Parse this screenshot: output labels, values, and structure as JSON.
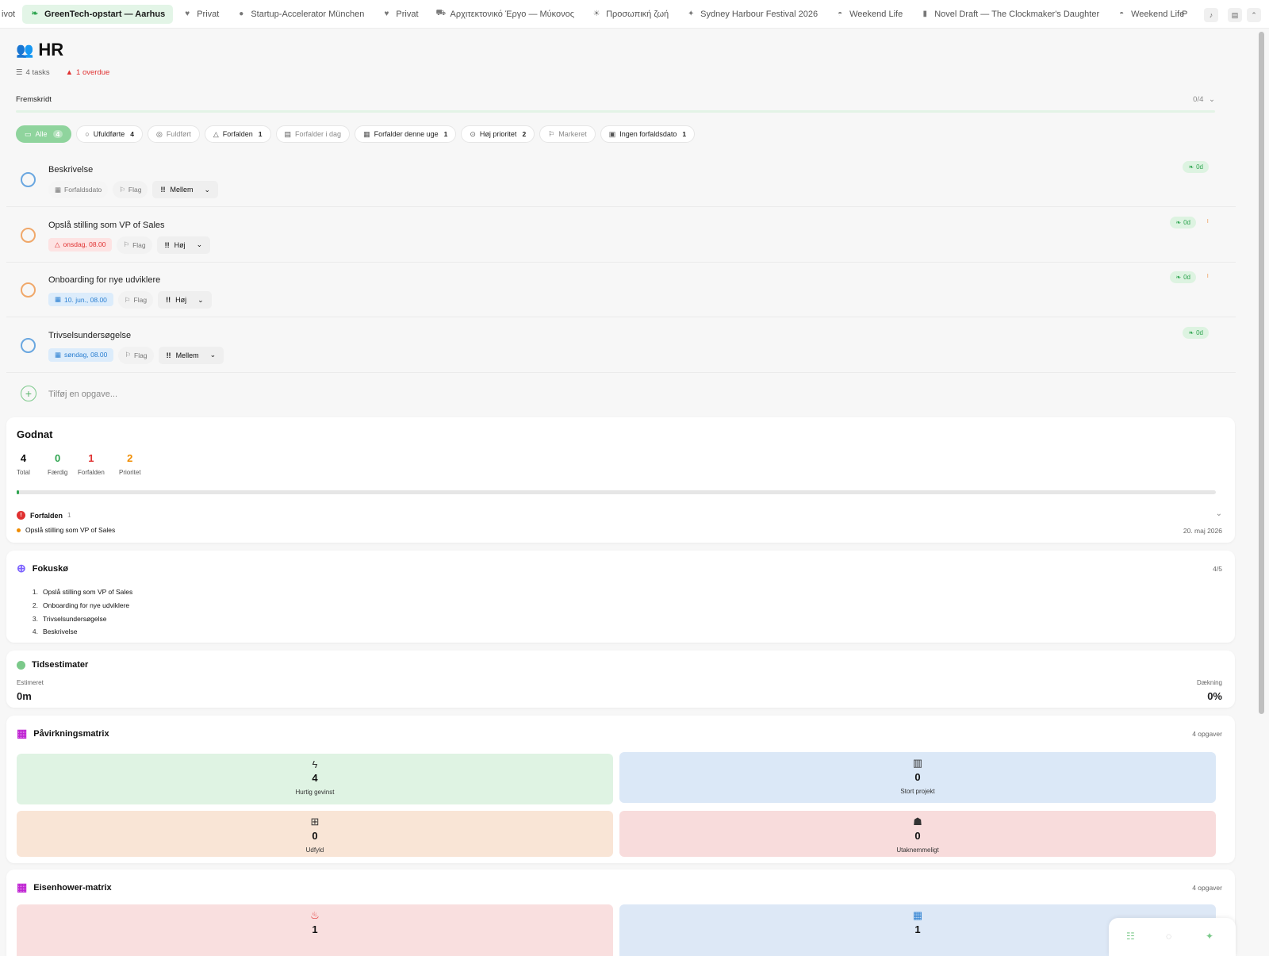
{
  "tabs": {
    "cut_left": "ivot",
    "items": [
      {
        "label": "GreenTech-opstart — Aarhus",
        "icon": "leaf-icon",
        "active": true
      },
      {
        "label": "Privat",
        "icon": "heart-icon"
      },
      {
        "label": "Startup-Accelerator München",
        "icon": "bulb-icon"
      },
      {
        "label": "Privat",
        "icon": "heart-icon"
      },
      {
        "label": "Αρχιτεκτονικό Έργο — Μύκονος",
        "icon": "car-icon"
      },
      {
        "label": "Προσωπική ζωή",
        "icon": "sun-icon"
      },
      {
        "label": "Sydney Harbour Festival 2026",
        "icon": "sparkle-icon"
      },
      {
        "label": "Weekend Life",
        "icon": "hat-icon"
      },
      {
        "label": "Novel Draft — The Clockmaker's Daughter",
        "icon": "book-icon"
      },
      {
        "label": "Weekend Life",
        "icon": "hat-icon"
      }
    ],
    "cut_right": "P"
  },
  "header": {
    "title": "HR",
    "title_icon": "people-icon",
    "tasks_count": "4 tasks",
    "overdue": "1 overdue"
  },
  "progress": {
    "label": "Fremskridt",
    "value": "0/4",
    "fraction": 0.0
  },
  "filters": [
    {
      "label": "Alle",
      "count": "4",
      "active": true,
      "icon": "inbox-icon"
    },
    {
      "label": "Ufuldførte",
      "count": "4",
      "icon": "circle-icon"
    },
    {
      "label": "Fuldført",
      "count": "",
      "muted": true,
      "icon": "check-circle-icon"
    },
    {
      "label": "Forfalden",
      "count": "1",
      "icon": "warning-icon"
    },
    {
      "label": "Forfalder i dag",
      "count": "",
      "muted": true,
      "icon": "calendar-clock-icon"
    },
    {
      "label": "Forfalder denne uge",
      "count": "1",
      "icon": "calendar-icon"
    },
    {
      "label": "Høj prioritet",
      "count": "2",
      "icon": "alert-circle-icon"
    },
    {
      "label": "Markeret",
      "count": "",
      "muted": true,
      "icon": "flag-icon"
    },
    {
      "label": "Ingen forfaldsdato",
      "count": "1",
      "icon": "calendar-x-icon"
    }
  ],
  "tasks": [
    {
      "name": "Beskrivelse",
      "date": "Forfaldsdato",
      "date_style": "none",
      "flag": "Flag",
      "priority": "Mellem",
      "badge": "0d",
      "circle": "blue"
    },
    {
      "name": "Opslå stilling som VP of Sales",
      "date": "onsdag, 08.00",
      "date_style": "red",
      "flag": "Flag",
      "priority": "Høj",
      "badge": "0d",
      "circle": "orange"
    },
    {
      "name": "Onboarding for nye udviklere",
      "date": "10. jun., 08.00",
      "date_style": "blue",
      "flag": "Flag",
      "priority": "Høj",
      "badge": "0d",
      "circle": "orange"
    },
    {
      "name": "Trivselsundersøgelse",
      "date": "søndag, 08.00",
      "date_style": "blue",
      "flag": "Flag",
      "priority": "Mellem",
      "badge": "0d",
      "circle": "blue"
    }
  ],
  "add_task_placeholder": "Tilføj en opgave...",
  "summary": {
    "title": "Godnat",
    "stats": [
      {
        "n": "4",
        "label": "Total",
        "color": "#111111"
      },
      {
        "n": "0",
        "label": "Færdig",
        "color": "#2ea44f"
      },
      {
        "n": "1",
        "label": "Forfalden",
        "color": "#e03131"
      },
      {
        "n": "2",
        "label": "Prioritet",
        "color": "#f08c00"
      }
    ],
    "completion_fraction": 0.0,
    "overdue_header": "Forfalden",
    "overdue_count": "1",
    "overdue_item": "Opslå stilling som VP of Sales",
    "overdue_date": "20. maj 2026"
  },
  "focus": {
    "title": "Fokuskø",
    "count": "4/5",
    "items": [
      {
        "num": "1.",
        "label": "Opslå stilling som VP of Sales"
      },
      {
        "num": "2.",
        "label": "Onboarding for nye udviklere"
      },
      {
        "num": "3.",
        "label": "Trivselsundersøgelse"
      },
      {
        "num": "4.",
        "label": "Beskrivelse"
      }
    ]
  },
  "time": {
    "title": "Tidsestimater",
    "estimated_label": "Estimeret",
    "estimated_value": "0m",
    "coverage_label": "Dækning",
    "coverage_value": "0%"
  },
  "impact": {
    "title": "Påvirkningsmatrix",
    "count": "4 opgaver",
    "quadrants": [
      {
        "icon": "bolt-icon",
        "n": "4",
        "label": "Hurtig gevinst",
        "color": "#dff3e3"
      },
      {
        "icon": "building-icon",
        "n": "0",
        "label": "Stort projekt",
        "color": "#dbe8f7"
      },
      {
        "icon": "grid-icon",
        "n": "0",
        "label": "Udfyld",
        "color": "#f9e5d6"
      },
      {
        "icon": "turtle-icon",
        "n": "0",
        "label": "Utaknemmeligt",
        "color": "#f8dcdc"
      }
    ]
  },
  "eisenhower": {
    "title": "Eisenhower-matrix",
    "count": "4 opgaver",
    "quadrants": [
      {
        "icon": "fire-icon",
        "n": "1",
        "color": "#f9dfdf"
      },
      {
        "icon": "calendar-icon",
        "n": "1",
        "color": "#dde8f6"
      }
    ]
  }
}
